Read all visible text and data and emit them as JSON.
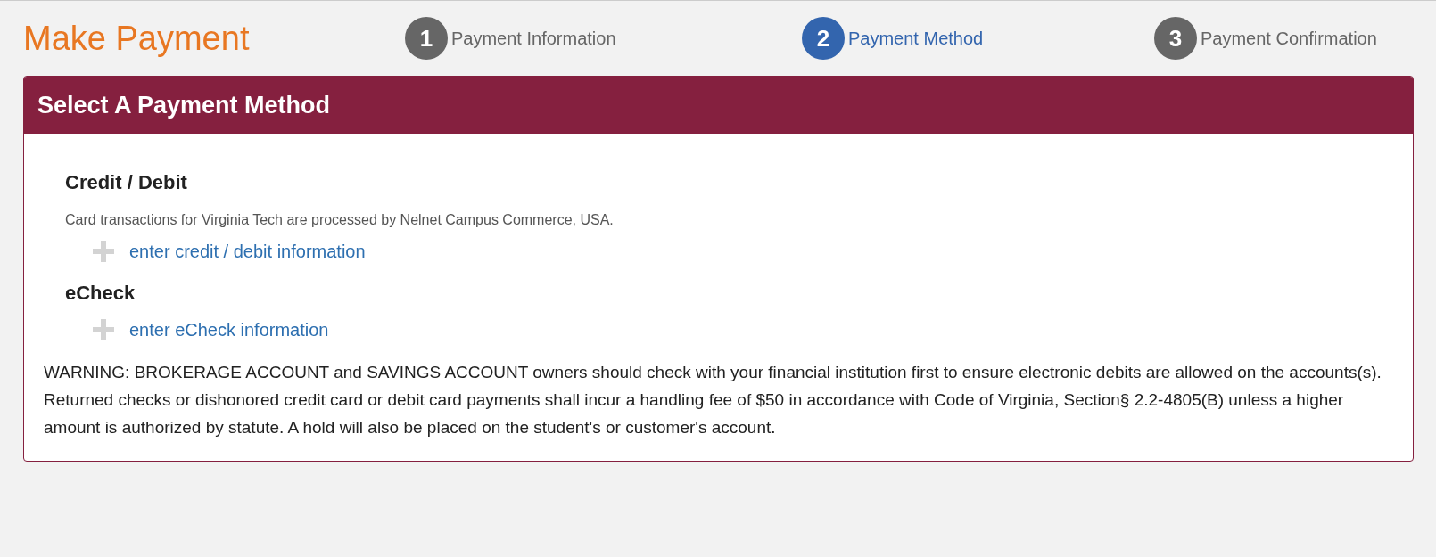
{
  "page_title": "Make Payment",
  "steps": [
    {
      "number": "1",
      "label": "Payment Information",
      "selected": false
    },
    {
      "number": "2",
      "label": "Payment Method",
      "selected": true
    },
    {
      "number": "3",
      "label": "Payment Confirmation",
      "selected": false
    }
  ],
  "panel": {
    "title": "Select A Payment Method",
    "methods": [
      {
        "heading": "Credit / Debit",
        "note": "Card transactions for Virginia Tech are processed by Nelnet Campus Commerce, USA.",
        "link": "enter credit / debit information"
      },
      {
        "heading": "eCheck",
        "link": "enter eCheck information"
      }
    ],
    "warning": "WARNING: BROKERAGE ACCOUNT and SAVINGS ACCOUNT owners should check with your financial institution first to ensure electronic debits are allowed on the accounts(s). Returned checks or dishonored credit card or debit card payments shall incur a handling fee of $50 in accordance with Code of Virginia, Section§ 2.2-4805(B) unless a higher amount is authorized by statute. A hold will also be placed on the student's or customer's account."
  }
}
